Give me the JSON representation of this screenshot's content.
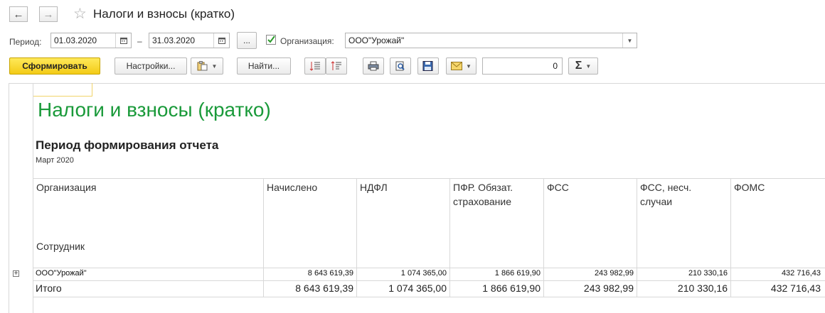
{
  "window": {
    "title": "Налоги и взносы (кратко)"
  },
  "nav": {
    "back_icon": "←",
    "forward_icon": "→",
    "star_icon": "☆"
  },
  "filters": {
    "period_label": "Период:",
    "date_from": "01.03.2020",
    "date_dash": "–",
    "date_to": "31.03.2020",
    "more_label": "...",
    "org_checked": true,
    "org_label": "Организация:",
    "org_value": "ООО\"Урожай\""
  },
  "toolbar": {
    "generate_label": "Сформировать",
    "settings_label": "Настройки...",
    "find_label": "Найти...",
    "number_value": "0",
    "sum_icon": "Σ"
  },
  "report": {
    "title": "Налоги и взносы (кратко)",
    "period_heading": "Период формирования отчета",
    "period_value": "Март 2020",
    "headers": {
      "org": "Организация",
      "employee": "Сотрудник",
      "accrued": "Начислено",
      "ndfl": "НДФЛ",
      "pfr_line1": "ПФР. Обязат.",
      "pfr_line2": "страхование",
      "fss": "ФСС",
      "fss_ns_line1": "ФСС, несч.",
      "fss_ns_line2": "случаи",
      "foms": "ФОМС"
    },
    "rows": [
      {
        "name": "ООО\"Урожай\"",
        "expand_icon": "+",
        "values": [
          "8 643 619,39",
          "1 074 365,00",
          "1 866 619,90",
          "243 982,99",
          "210 330,16",
          "432 716,43"
        ]
      }
    ],
    "total": {
      "name": "Итого",
      "values": [
        "8 643 619,39",
        "1 074 365,00",
        "1 866 619,90",
        "243 982,99",
        "210 330,16",
        "432 716,43"
      ]
    }
  },
  "colors": {
    "report_title": "#1a9a3a",
    "primary_button": "#f5d321"
  }
}
